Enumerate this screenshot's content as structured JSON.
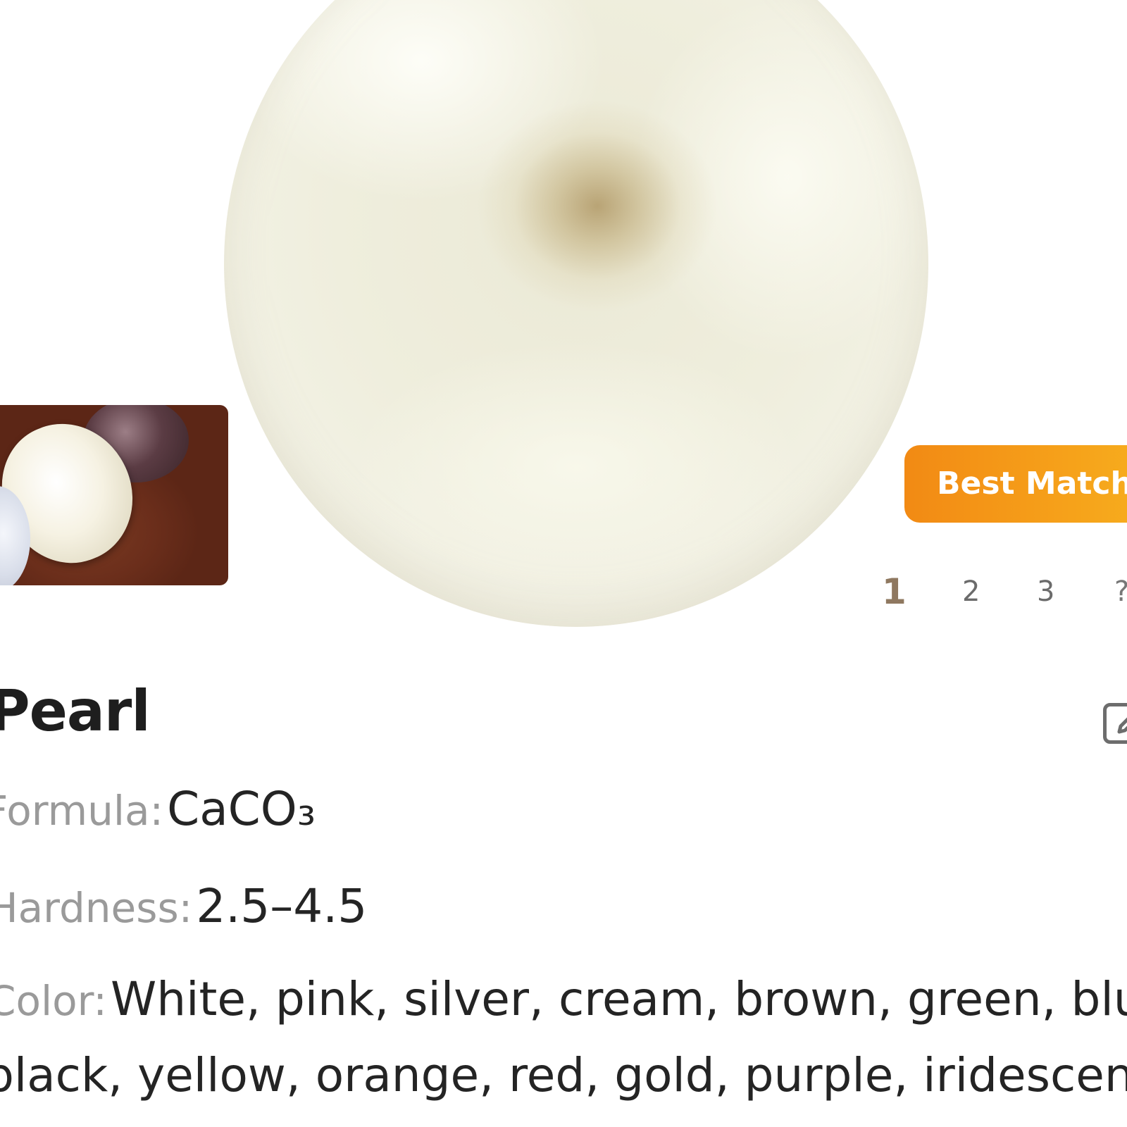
{
  "badge": {
    "label": "Best Match"
  },
  "pagination": {
    "pages": [
      "1",
      "2",
      "3",
      "?"
    ],
    "current": "1"
  },
  "mineral": {
    "name": "Pearl",
    "formula_label": "Formula:",
    "formula_value": "CaCO₃",
    "hardness_label": "Hardness:",
    "hardness_value": "2.5–4.5",
    "color_label": "Color:",
    "color_value_line1": "White, pink, silver, cream, brown, green, blue,",
    "color_value_line2": "black, yellow, orange, red, gold, purple, iridescent"
  },
  "colors": {
    "badge_start": "#f28a14",
    "badge_end": "#f7ad1e",
    "active_page": "#8f7860"
  },
  "icons": {
    "edit": "edit-icon"
  }
}
